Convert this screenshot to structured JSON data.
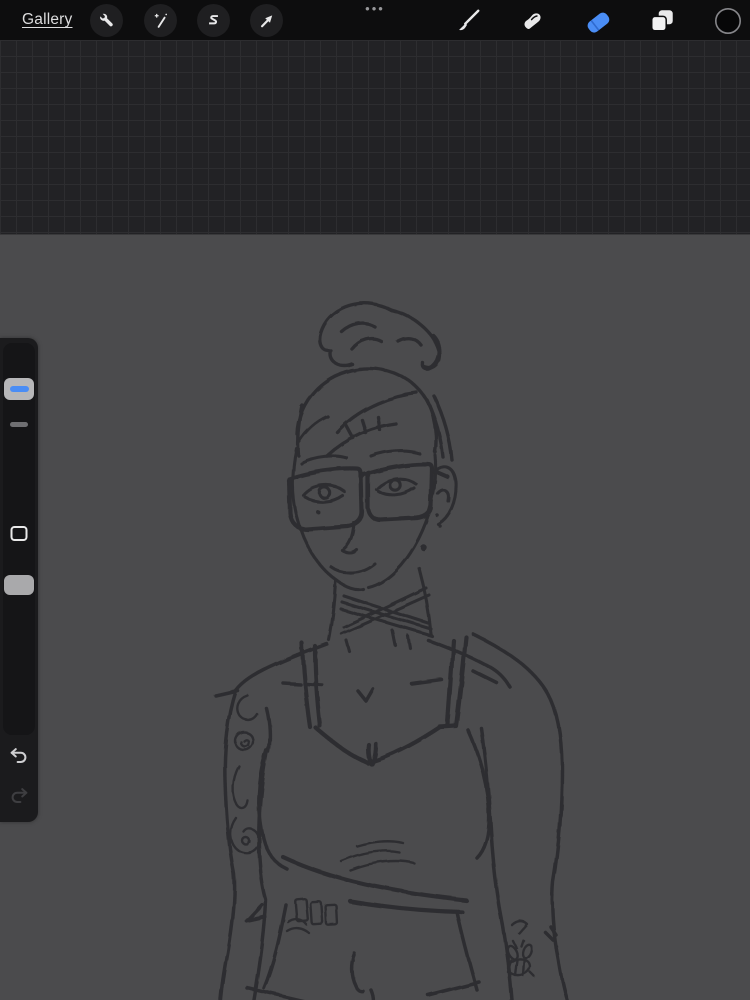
{
  "toolbar": {
    "gallery_label": "Gallery",
    "multitask_indicator": "•••",
    "left_tools": [
      {
        "name": "actions",
        "icon": "wrench-icon"
      },
      {
        "name": "adjustments",
        "icon": "magic-wand-icon"
      },
      {
        "name": "selection",
        "icon": "s-curve-icon"
      },
      {
        "name": "transform",
        "icon": "arrow-cursor-icon"
      }
    ],
    "right_tools": [
      {
        "name": "paint",
        "icon": "brush-icon",
        "active": false
      },
      {
        "name": "smudge",
        "icon": "smudge-finger-icon",
        "active": false
      },
      {
        "name": "erase",
        "icon": "eraser-icon",
        "active": true
      },
      {
        "name": "layers",
        "icon": "layers-icon",
        "active": false
      },
      {
        "name": "color",
        "icon": "color-swatch-icon",
        "active": false,
        "swatch_color": "#070708"
      }
    ]
  },
  "sidebar": {
    "size_slider_handle": {
      "icon": "brush-size-handle",
      "accent_bar": true
    },
    "middle_tick": {
      "icon": "slider-midpoint-tick"
    },
    "modify_button": {
      "icon": "modify-square-icon"
    },
    "opacity_slider_handle": {
      "icon": "opacity-handle"
    },
    "undo": {
      "icon": "undo-arrow-icon",
      "enabled": true
    },
    "redo": {
      "icon": "redo-arrow-icon",
      "enabled": false
    }
  },
  "colors": {
    "accent": "#4a8df5",
    "toolbar_bg": "#0d0d0e",
    "button_bg": "#1f1f21",
    "icon": "#e8e8e9",
    "grid_bg": "#222225",
    "grid_line": "#2d2d30",
    "canvas_bg": "#4b4b4d",
    "panel_bg": "#1b1b1d",
    "track_bg": "#151517",
    "sketch_stroke": "#2b2b2d",
    "swatch_black": "#070708",
    "eraser_tip_line": "#2f6ad0"
  }
}
